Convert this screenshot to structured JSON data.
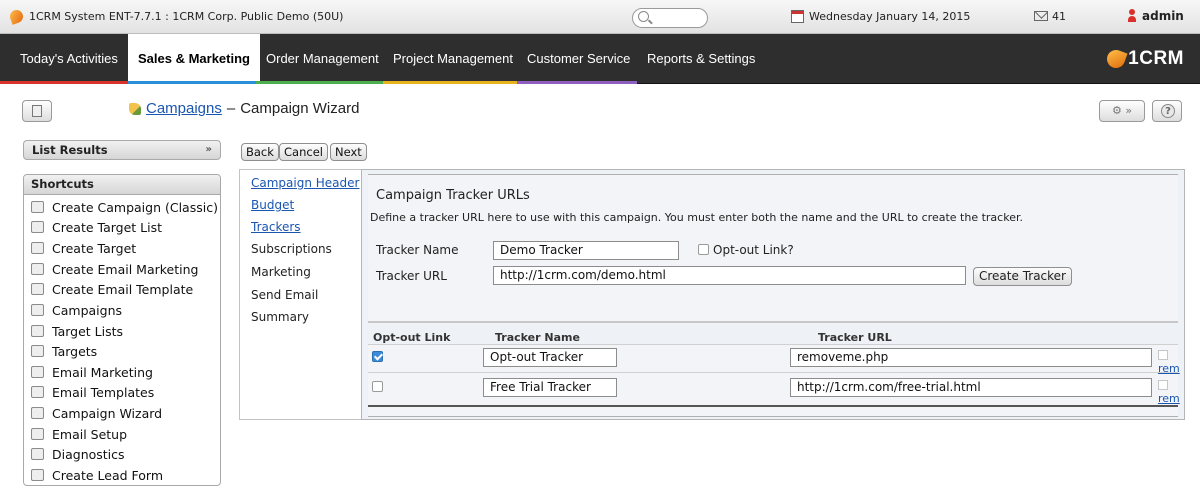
{
  "topbar": {
    "title": "1CRM System ENT-7.7.1 : 1CRM Corp. Public Demo (50U)",
    "date": "Wednesday January 14, 2015",
    "mail_count": "41",
    "user": "admin"
  },
  "nav": {
    "tabs": [
      {
        "label": "Today's Activities"
      },
      {
        "label": "Sales & Marketing"
      },
      {
        "label": "Order Management"
      },
      {
        "label": "Project Management"
      },
      {
        "label": "Customer Service"
      },
      {
        "label": "Reports & Settings"
      }
    ],
    "active_tab": "Sales & Marketing",
    "brand": "1CRM",
    "stripe_colors": [
      "#d9322d",
      "#2a8fd8",
      "#4cae4c",
      "#e7b21e",
      "#8f5fc0"
    ]
  },
  "header": {
    "module_link": "Campaigns",
    "separator": "–",
    "page_title": "Campaign Wizard",
    "settings_chevron": "»"
  },
  "sidebar": {
    "list_results_label": "List Results",
    "shortcuts_label": "Shortcuts",
    "items": [
      {
        "label": "Create Campaign (Classic)",
        "icon": "campaign-icon"
      },
      {
        "label": "Create Target List",
        "icon": "target-list-icon"
      },
      {
        "label": "Create Target",
        "icon": "target-icon"
      },
      {
        "label": "Create Email Marketing",
        "icon": "email-marketing-icon"
      },
      {
        "label": "Create Email Template",
        "icon": "email-template-icon"
      },
      {
        "label": "Campaigns",
        "icon": "campaign-icon"
      },
      {
        "label": "Target Lists",
        "icon": "target-list-icon"
      },
      {
        "label": "Targets",
        "icon": "target-icon"
      },
      {
        "label": "Email Marketing",
        "icon": "email-marketing-icon"
      },
      {
        "label": "Email Templates",
        "icon": "email-template-icon"
      },
      {
        "label": "Campaign Wizard",
        "icon": "campaign-icon"
      },
      {
        "label": "Email Setup",
        "icon": "email-setup-icon"
      },
      {
        "label": "Diagnostics",
        "icon": "diagnostics-icon"
      },
      {
        "label": "Create Lead Form",
        "icon": "lead-form-icon"
      }
    ]
  },
  "buttons": {
    "back": "Back",
    "cancel": "Cancel",
    "next": "Next"
  },
  "steps": [
    {
      "label": "Campaign Header",
      "link": true
    },
    {
      "label": "Budget",
      "link": true
    },
    {
      "label": "Trackers",
      "link": true
    },
    {
      "label": "Subscriptions",
      "link": false
    },
    {
      "label": "Marketing",
      "link": false
    },
    {
      "label": "Send Email",
      "link": false
    },
    {
      "label": "Summary",
      "link": false
    }
  ],
  "trackers": {
    "title": "Campaign Tracker URLs",
    "description": "Define a tracker URL here to use with this campaign. You must enter both the name and the URL to create the tracker.",
    "name_label": "Tracker Name",
    "name_value": "Demo Tracker",
    "optout_label": "Opt-out Link?",
    "url_label": "Tracker URL",
    "url_value": "http://1crm.com/demo.html",
    "create_button": "Create Tracker",
    "columns": [
      "Opt-out Link",
      "Tracker Name",
      "Tracker URL"
    ],
    "rows": [
      {
        "optout": true,
        "name": "Opt-out Tracker",
        "url": "removeme.php",
        "remove": "rem"
      },
      {
        "optout": false,
        "name": "Free Trial Tracker",
        "url": "http://1crm.com/free-trial.html",
        "remove": "rem"
      }
    ]
  }
}
